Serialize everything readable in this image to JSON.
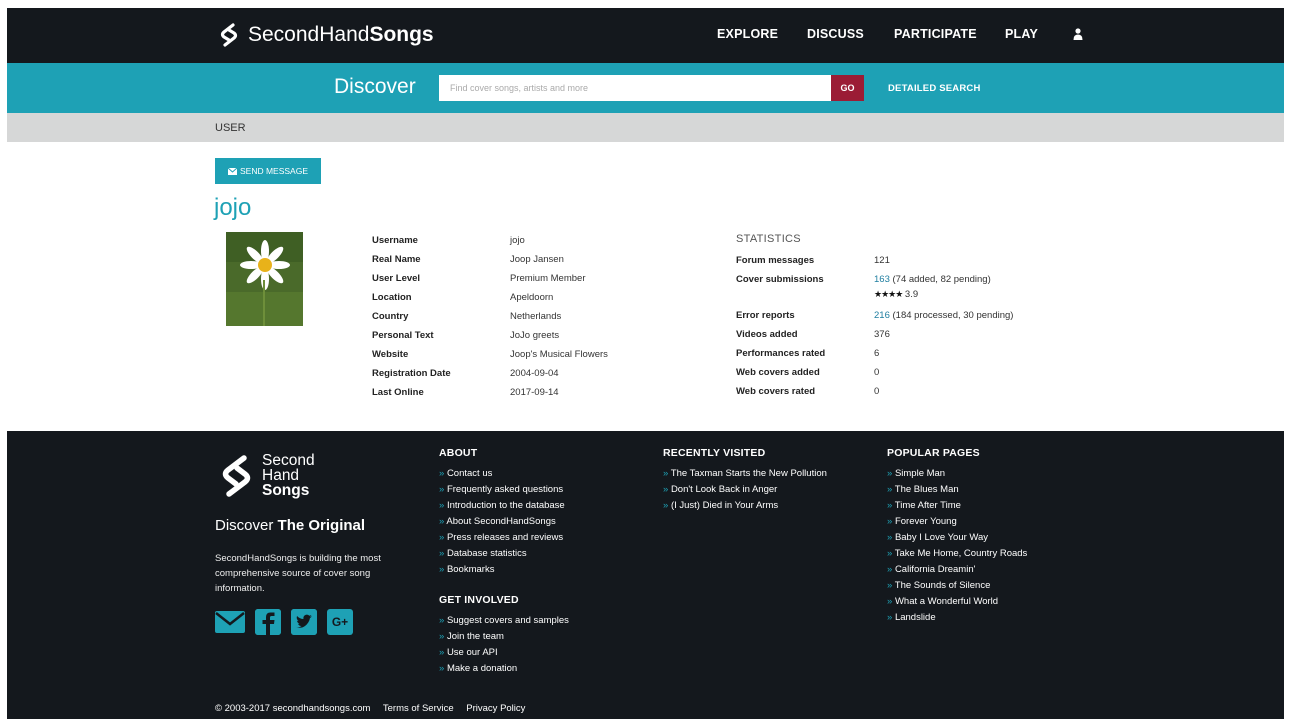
{
  "header": {
    "logo_regular": "SecondHand",
    "logo_bold": "Songs",
    "nav": [
      "EXPLORE",
      "DISCUSS",
      "PARTICIPATE",
      "PLAY"
    ]
  },
  "search": {
    "title": "Discover",
    "placeholder": "Find cover songs, artists and more",
    "go_label": "GO",
    "detailed_label": "DETAILED SEARCH"
  },
  "breadcrumb": "USER",
  "profile": {
    "send_message_label": "SEND MESSAGE",
    "username_title": "jojo",
    "fields": [
      {
        "label": "Username",
        "value": "jojo"
      },
      {
        "label": "Real Name",
        "value": "Joop Jansen"
      },
      {
        "label": "User Level",
        "value": "Premium Member"
      },
      {
        "label": "Location",
        "value": "Apeldoorn"
      },
      {
        "label": "Country",
        "value": "Netherlands"
      },
      {
        "label": "Personal Text",
        "value": "JoJo greets"
      },
      {
        "label": "Website",
        "value": "Joop's Musical Flowers"
      },
      {
        "label": "Registration Date",
        "value": "2004-09-04"
      },
      {
        "label": "Last Online",
        "value": "2017-09-14"
      }
    ]
  },
  "statistics": {
    "title": "STATISTICS",
    "forum_messages": {
      "label": "Forum messages",
      "value": "121"
    },
    "cover_submissions": {
      "label": "Cover submissions",
      "value": "163",
      "extra": "(74 added, 82 pending)",
      "rating": "3.9"
    },
    "error_reports": {
      "label": "Error reports",
      "value": "216",
      "extra": "(184 processed, 30 pending)"
    },
    "videos_added": {
      "label": "Videos added",
      "value": "376"
    },
    "performances_rated": {
      "label": "Performances rated",
      "value": "6"
    },
    "web_covers_added": {
      "label": "Web covers added",
      "value": "0"
    },
    "web_covers_rated": {
      "label": "Web covers rated",
      "value": "0"
    }
  },
  "footer": {
    "logo_lines": [
      "Second",
      "Hand",
      "Songs"
    ],
    "tagline_regular": "Discover",
    "tagline_bold": "The Original",
    "description": "SecondHandSongs is building the most comprehensive source of cover song information.",
    "about": {
      "title": "ABOUT",
      "links": [
        "Contact us",
        "Frequently asked questions",
        "Introduction to the database",
        "About SecondHandSongs",
        "Press releases and reviews",
        "Database statistics",
        "Bookmarks"
      ]
    },
    "get_involved": {
      "title": "GET INVOLVED",
      "links": [
        "Suggest covers and samples",
        "Join the team",
        "Use our API",
        "Make a donation"
      ]
    },
    "recently_visited": {
      "title": "RECENTLY VISITED",
      "links": [
        "The Taxman Starts the New Pollution",
        "Don't Look Back in Anger",
        "(I Just) Died in Your Arms"
      ]
    },
    "popular_pages": {
      "title": "POPULAR PAGES",
      "links": [
        "Simple Man",
        "The Blues Man",
        "Time After Time",
        "Forever Young",
        "Baby I Love Your Way",
        "Take Me Home, Country Roads",
        "California Dreamin'",
        "The Sounds of Silence",
        "What a Wonderful World",
        "Landslide"
      ]
    },
    "copyright": "© 2003-2017 secondhandsongs.com",
    "terms": "Terms of Service",
    "privacy": "Privacy Policy"
  },
  "colors": {
    "dark": "#14181d",
    "teal": "#1ea1b5",
    "go_red": "#9b1c35",
    "crumb_gray": "#d6d7d7",
    "link": "#1f7ea0"
  },
  "icons": [
    "logo-icon",
    "user-icon",
    "envelope-icon",
    "email-icon",
    "facebook-icon",
    "twitter-icon",
    "google-plus-icon",
    "star-icon"
  ]
}
